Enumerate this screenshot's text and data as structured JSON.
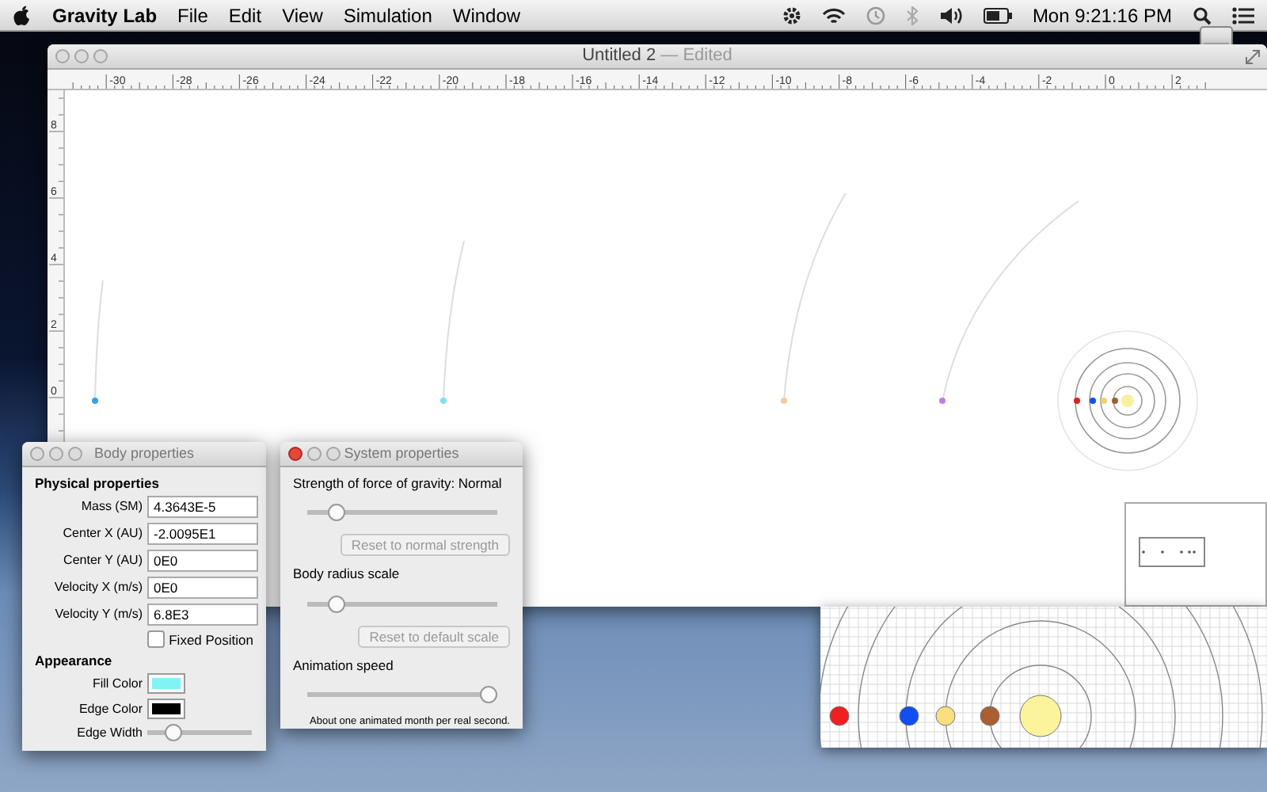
{
  "menu_bar": {
    "app_name": "Gravity Lab",
    "menus": [
      "File",
      "Edit",
      "View",
      "Simulation",
      "Window"
    ],
    "clock": "Mon 9:21:16 PM"
  },
  "document_window": {
    "title": "Untitled 2",
    "status": "— Edited",
    "ruler_x_labels": [
      "-30",
      "-28",
      "-26",
      "-24",
      "-22",
      "-20",
      "-18",
      "-16",
      "-14",
      "-12",
      "-10",
      "-8",
      "-6",
      "-4",
      "-2",
      "0",
      "2"
    ],
    "ruler_y_labels": [
      "8",
      "6",
      "4",
      "2",
      "0"
    ]
  },
  "body_properties": {
    "title": "Body properties",
    "physical_heading": "Physical properties",
    "fields": [
      {
        "label": "Mass (SM)",
        "value": "4.3643E-5"
      },
      {
        "label": "Center X (AU)",
        "value": "-2.0095E1"
      },
      {
        "label": "Center Y (AU)",
        "value": "0E0"
      },
      {
        "label": "Velocity X (m/s)",
        "value": "0E0"
      },
      {
        "label": "Velocity Y (m/s)",
        "value": "6.8E3"
      }
    ],
    "fixed_position": {
      "label": "Fixed Position",
      "checked": false
    },
    "appearance_heading": "Appearance",
    "fill_color": {
      "label": "Fill Color",
      "color": "#80f4f4"
    },
    "edge_color": {
      "label": "Edge Color",
      "color": "#000000"
    },
    "edge_width": {
      "label": "Edge Width",
      "level": 0.2
    }
  },
  "system_properties": {
    "title": "System properties",
    "gravity": {
      "label": "Strength of force of gravity: Normal",
      "level": 0.12,
      "button": "Reset to normal strength",
      "disabled": true
    },
    "radius": {
      "label": "Body radius scale",
      "level": 0.12,
      "button": "Reset to default scale",
      "disabled": true
    },
    "speed": {
      "label": "Animation speed",
      "level": 1.0,
      "note": "About one animated month per real second."
    }
  }
}
